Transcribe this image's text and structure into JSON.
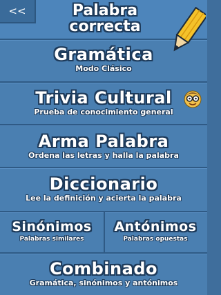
{
  "header": {
    "back_label": "<<",
    "logo_line1": "Palabra",
    "logo_line2": "correcta"
  },
  "menu": {
    "gramatica": {
      "title": "Gramática",
      "subtitle": "Modo Clásico"
    },
    "trivia": {
      "title": "Trivia Cultural",
      "subtitle": "Prueba de conocimiento general"
    },
    "arma": {
      "title": "Arma Palabra",
      "subtitle": "Ordena las letras y halla la palabra"
    },
    "diccionario": {
      "title": "Diccionario",
      "subtitle": "Lee la definición y acierta la palabra"
    },
    "sinonimos": {
      "title": "Sinónimos",
      "subtitle": "Palabras similares"
    },
    "antonimos": {
      "title": "Antónimos",
      "subtitle": "Palabras opuestas"
    },
    "combinado": {
      "title": "Combinado",
      "subtitle": "Gramática, sinónimos y antónimos"
    }
  },
  "colors": {
    "background": "#3f6e9c",
    "item": "#4a7fb1",
    "outline": "#1d3a5a"
  }
}
